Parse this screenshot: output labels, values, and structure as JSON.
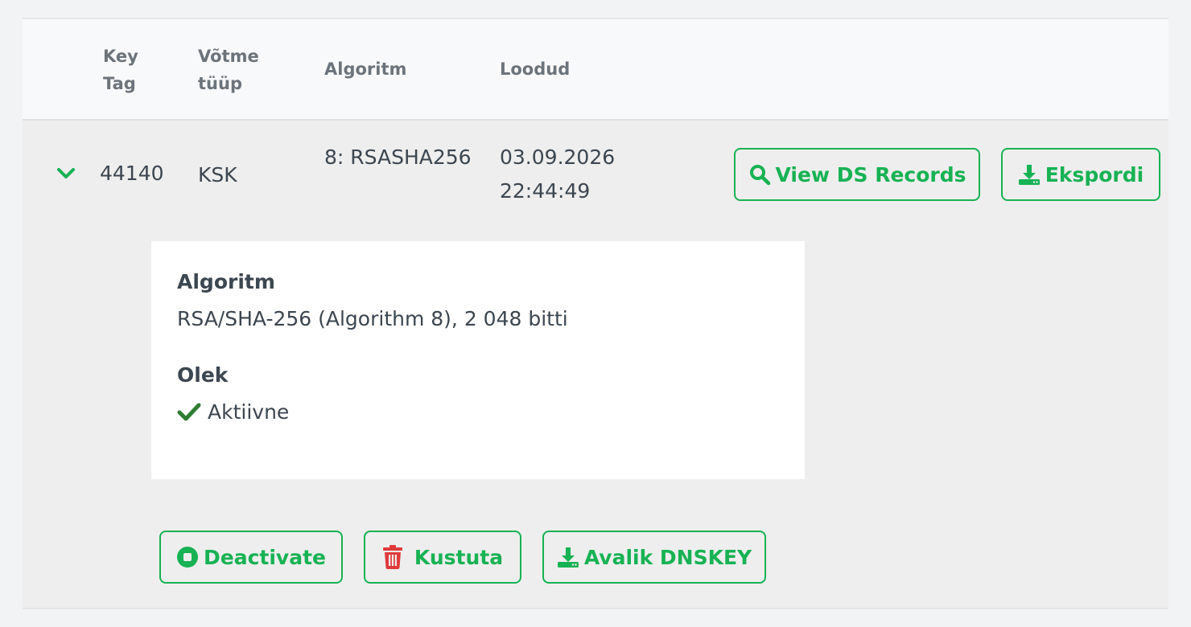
{
  "columns": {
    "key_tag": "Key Tag",
    "key_type": "Võtme tüüp",
    "algorithm": "Algoritm",
    "created": "Loodud"
  },
  "row": {
    "key_tag": "44140",
    "key_type": "KSK",
    "algorithm": "8: RSASHA256",
    "created": "03.09.2026 22:44:49",
    "actions": {
      "view_ds": "View DS Records",
      "export": "Ekspordi"
    },
    "details": {
      "algorithm_label": "Algoritm",
      "algorithm_value": "RSA/SHA-256 (Algorithm 8), 2 048 bitti",
      "state_label": "Olek",
      "state_value": "Aktiivne"
    },
    "bottom_actions": {
      "deactivate": "Deactivate",
      "delete": "Kustuta",
      "public_dnskey": "Avalik DNSKEY"
    }
  },
  "icons": {
    "expand": "chevron-down-icon",
    "view_ds": "search-icon",
    "export": "download-icon",
    "state": "check-icon",
    "deactivate": "stop-circle-icon",
    "delete": "trash-icon",
    "public_dnskey": "download-icon"
  },
  "colors": {
    "accent": "#17b253",
    "danger": "#e03a3a",
    "success_check": "#2e7d32",
    "text": "#3c4650",
    "header_text": "#6b737b"
  }
}
